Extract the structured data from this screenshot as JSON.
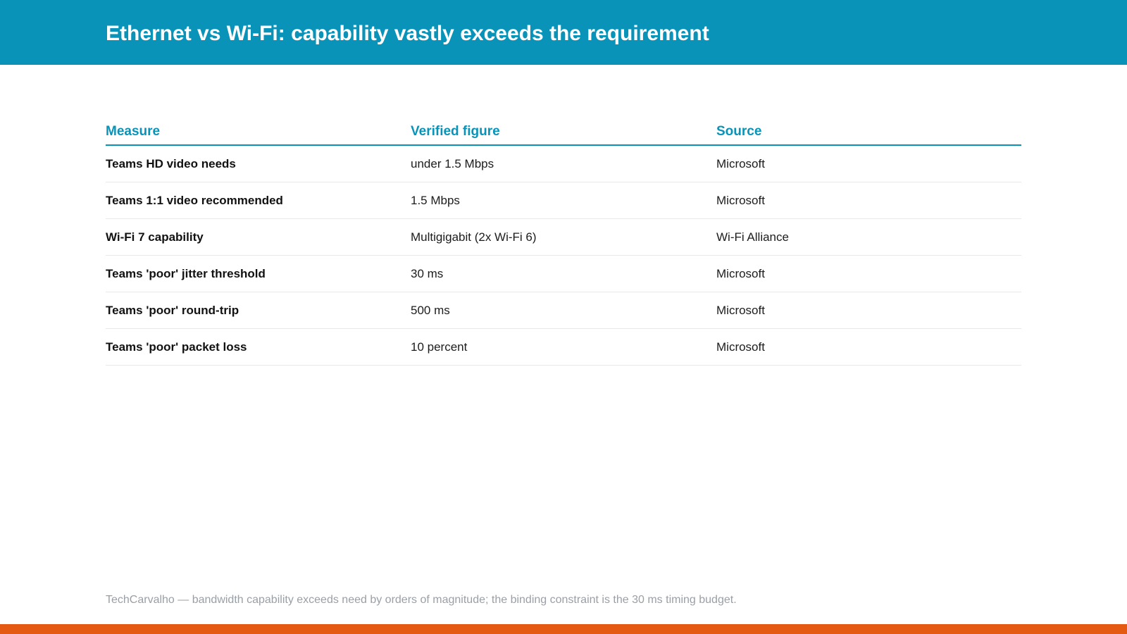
{
  "slide": {
    "title": "Ethernet vs Wi-Fi: capability vastly exceeds the requirement",
    "table": {
      "headers": [
        "Measure",
        "Verified figure",
        "Source"
      ],
      "rows": [
        {
          "measure": "Teams HD video needs",
          "figure": "under 1.5 Mbps",
          "source": "Microsoft"
        },
        {
          "measure": "Teams 1:1 video recommended",
          "figure": "1.5 Mbps",
          "source": "Microsoft"
        },
        {
          "measure": "Wi-Fi 7 capability",
          "figure": "Multigigabit (2x Wi-Fi 6)",
          "source": "Wi-Fi Alliance"
        },
        {
          "measure": "Teams 'poor' jitter threshold",
          "figure": "30 ms",
          "source": "Microsoft"
        },
        {
          "measure": "Teams 'poor' round-trip",
          "figure": "500 ms",
          "source": "Microsoft"
        },
        {
          "measure": "Teams 'poor' packet loss",
          "figure": "10 percent",
          "source": "Microsoft"
        }
      ]
    },
    "footnote": "TechCarvalho — bandwidth capability exceeds need by orders of magnitude; the binding constraint is the 30 ms timing budget."
  },
  "colors": {
    "header_bar": "#0a93b8",
    "accent": "#0a93b8",
    "bottom_bar": "#e45a12",
    "footnote_text": "#9a9fa6"
  }
}
